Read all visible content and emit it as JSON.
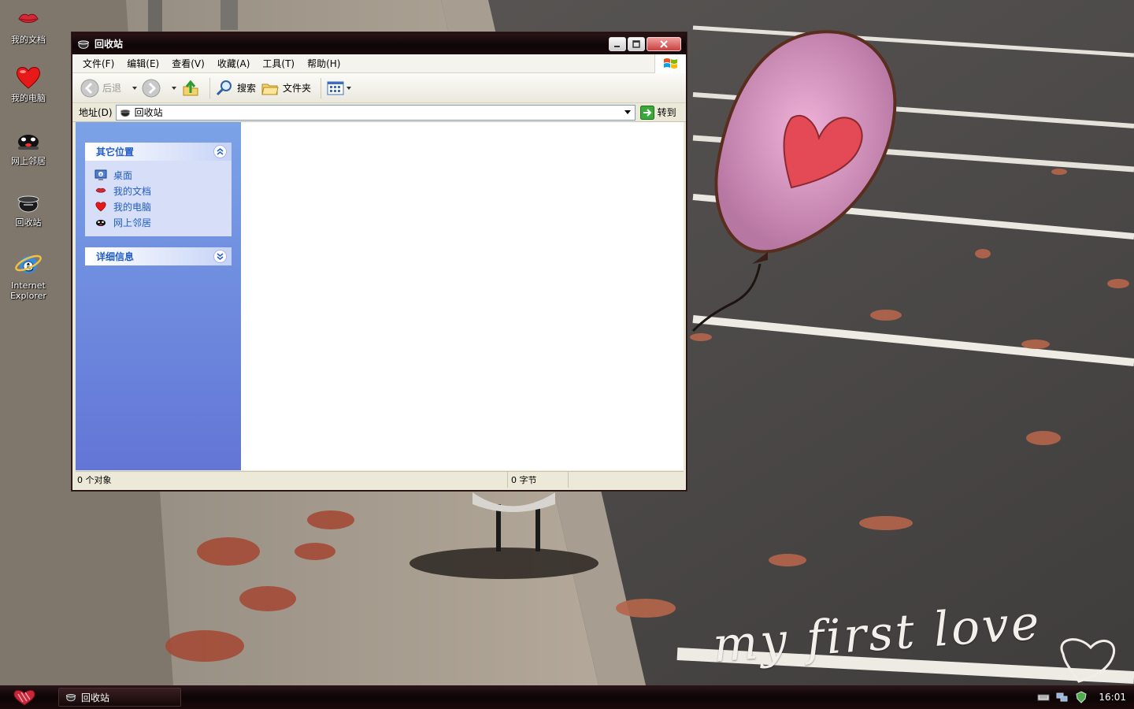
{
  "desktop": {
    "icons": [
      {
        "label": "我的文档"
      },
      {
        "label": "我的电脑"
      },
      {
        "label": "网上邻居"
      },
      {
        "label": "回收站"
      },
      {
        "label": "Internet Explorer"
      }
    ],
    "wallpaper_text": "my first love"
  },
  "window": {
    "title": "回收站",
    "menu": [
      "文件(F)",
      "编辑(E)",
      "查看(V)",
      "收藏(A)",
      "工具(T)",
      "帮助(H)"
    ],
    "toolbar": {
      "back": "后退",
      "search": "搜索",
      "folders": "文件夹"
    },
    "address": {
      "label": "地址(D)",
      "value": "回收站",
      "go": "转到"
    },
    "taskpane": {
      "other_places": {
        "title": "其它位置",
        "links": [
          "桌面",
          "我的文档",
          "我的电脑",
          "网上邻居"
        ]
      },
      "details": {
        "title": "详细信息"
      }
    },
    "status": {
      "objects": "0 个对象",
      "size": "0 字节"
    }
  },
  "taskbar": {
    "task_label": "回收站",
    "clock": "16:01"
  },
  "colors": {
    "link": "#215dc6",
    "taskpane_top": "#7ba2e7",
    "taskpane_bottom": "#6375d6",
    "titlebar": "#0d0506"
  }
}
